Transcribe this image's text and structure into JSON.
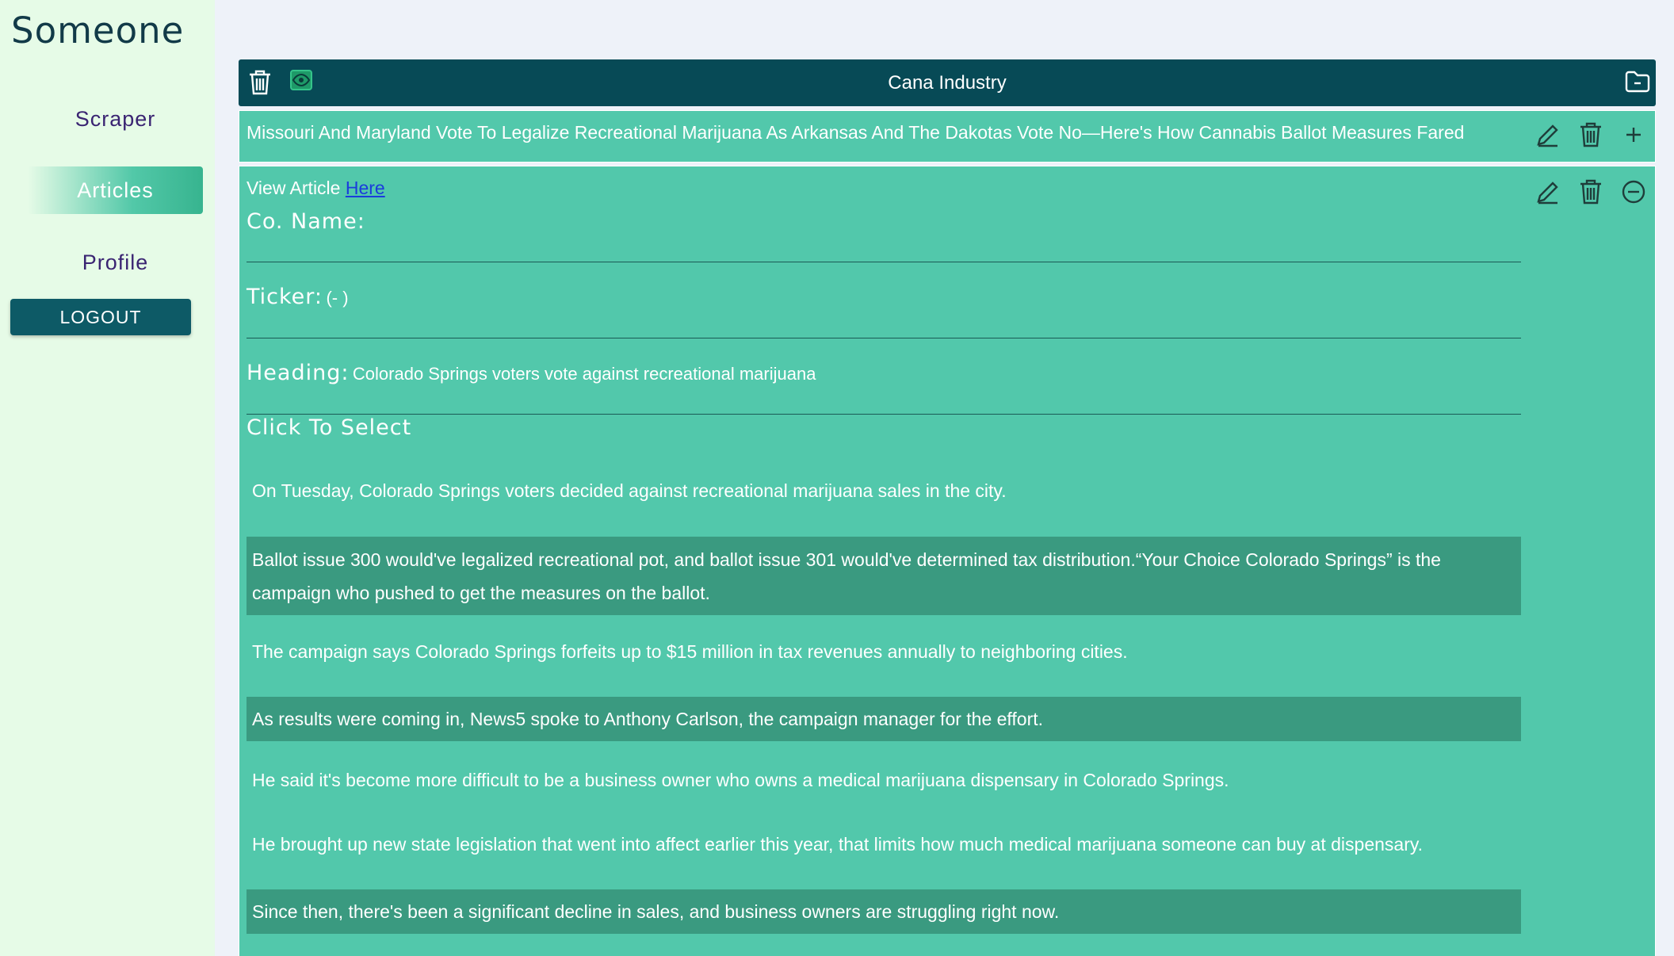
{
  "sidebar": {
    "brand": "Someone",
    "nav": [
      {
        "label": "Scraper"
      },
      {
        "label": "Articles",
        "active": true
      },
      {
        "label": "Profile"
      }
    ],
    "logout_label": "LOGOUT"
  },
  "header": {
    "title": "Cana Industry",
    "icons": [
      "trash-icon",
      "eye-icon",
      "folder-icon"
    ]
  },
  "article": {
    "title": "Missouri And Maryland Vote To Legalize Recreational Marijuana As Arkansas And The Dakotas Vote No—Here's How Cannabis Ballot Measures Fared",
    "icons": [
      "edit-icon",
      "trash-icon",
      "plus-icon"
    ]
  },
  "detail": {
    "view_prefix": "View Article",
    "view_link": "Here",
    "co_name_label": "Co. Name:",
    "co_name_value": "",
    "ticker_label": "Ticker:",
    "ticker_value": "(- )",
    "heading_label": "Heading:",
    "heading_value": "Colorado Springs voters vote against recreational marijuana",
    "select_title": "Click To Select",
    "icons": [
      "edit-icon",
      "trash-icon",
      "minus-circle-icon"
    ],
    "paragraphs": [
      {
        "text": "On Tuesday, Colorado Springs voters decided against recreational marijuana sales in the city.",
        "selected": false
      },
      {
        "text": "Ballot issue 300 would've legalized recreational pot, and ballot issue 301 would've determined tax distribution.“Your Choice Colorado Springs” is the campaign who pushed to get the measures on the ballot.",
        "selected": true
      },
      {
        "text": "The campaign says Colorado Springs forfeits up to $15 million in tax revenues annually to neighboring cities.",
        "selected": false
      },
      {
        "text": "As results were coming in, News5 spoke to Anthony Carlson, the campaign manager for the effort.",
        "selected": true
      },
      {
        "text": "He said it's become more difficult to be a business owner who owns a medical marijuana dispensary in Colorado Springs.",
        "selected": false
      },
      {
        "text": "He brought up new state legislation that went into affect earlier this year, that limits how much medical marijuana someone can buy at dispensary.",
        "selected": false
      },
      {
        "text": "Since then, there's been a significant decline in sales, and business owners are struggling right now.",
        "selected": true
      }
    ]
  },
  "colors": {
    "sidebar_bg": "#e6fbe7",
    "header_bg": "#074a56",
    "panel_bg": "#52c8ab",
    "selected_bg": "#3a9a80",
    "logout_bg": "#0d5a66",
    "nav_text": "#3a2472"
  }
}
